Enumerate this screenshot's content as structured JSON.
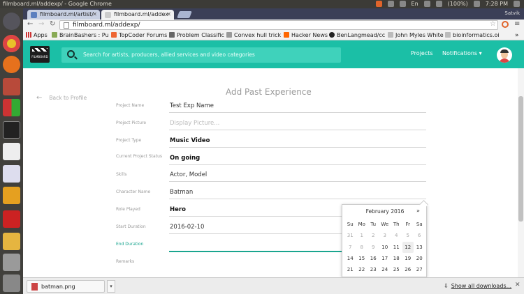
{
  "os": {
    "window_title": "filmboard.ml/addexp/ - Google Chrome",
    "battery": "(100%)",
    "time": "7:28 PM",
    "keyboard": "En"
  },
  "browser": {
    "tabs": [
      {
        "label": "filmboard.ml/artist/",
        "active": false
      },
      {
        "label": "filmboard.ml/addex",
        "active": true
      }
    ],
    "user": "Satvik",
    "url": "filmboard.ml/addexp/",
    "bookmarks": [
      "Apps",
      "BrainBashers : Pu",
      "TopCoder Forums",
      "Problem Classific",
      "Convex hull trick",
      "Hacker News",
      "BenLangmead/cc",
      "John Myles White",
      "bioinformatics.oi"
    ]
  },
  "header": {
    "logo_text": "FILMBOARD",
    "search_placeholder": "Search for artists, producers, allied services and video categories",
    "nav_projects": "Projects",
    "nav_notifications": "Notifications ▾"
  },
  "page": {
    "back_label": "Back to Profile",
    "title": "Add Past Experience",
    "fields": [
      {
        "label": "Project Name",
        "value": "Test Exp Name",
        "style": "normal"
      },
      {
        "label": "Project Picture",
        "value": "Display Picture...",
        "style": "placeholder"
      },
      {
        "label": "Project Type",
        "value": "Music Video",
        "style": "bold"
      },
      {
        "label": "Current Project Status",
        "value": "On going",
        "style": "bold"
      },
      {
        "label": "Skills",
        "value": "Actor, Model",
        "style": "normal"
      },
      {
        "label": "Character Name",
        "value": "Batman",
        "style": "normal"
      },
      {
        "label": "Role Played",
        "value": "Hero",
        "style": "bold"
      },
      {
        "label": "Start Duration",
        "value": "2016-02-10",
        "style": "normal"
      },
      {
        "label": "End Duration",
        "value": "",
        "style": "focus"
      },
      {
        "label": "Remarks",
        "value": "",
        "style": "normal"
      }
    ]
  },
  "datepicker": {
    "month": "February 2016",
    "next": "»",
    "weekdays": [
      "Su",
      "Mo",
      "Tu",
      "We",
      "Th",
      "Fr",
      "Sa"
    ],
    "weeks": [
      [
        "31",
        "1",
        "2",
        "3",
        "4",
        "5",
        "6"
      ],
      [
        "7",
        "8",
        "9",
        "10",
        "11",
        "12",
        "13"
      ],
      [
        "14",
        "15",
        "16",
        "17",
        "18",
        "19",
        "20"
      ],
      [
        "21",
        "22",
        "23",
        "24",
        "25",
        "26",
        "27"
      ]
    ],
    "today": "12"
  },
  "downloads": {
    "file": "batman.png",
    "show_all": "Show all downloads..."
  }
}
